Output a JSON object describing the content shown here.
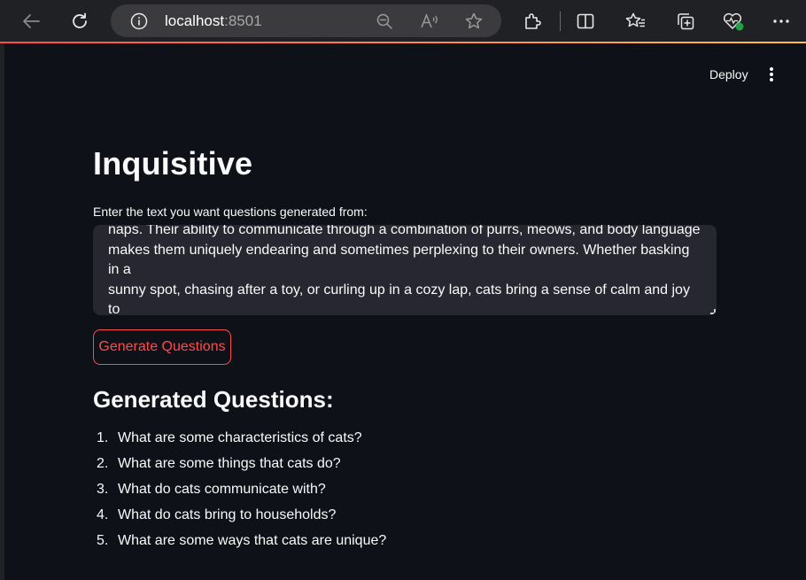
{
  "browser": {
    "url_host": "localhost",
    "url_port": ":8501",
    "icons": [
      "back-icon",
      "refresh-icon",
      "info-icon",
      "zoom-icon",
      "read-aloud-icon",
      "favorite-star-icon",
      "extensions-icon",
      "split-screen-icon",
      "favorites-icon",
      "collections-icon",
      "browser-essentials-icon",
      "more-icon"
    ],
    "accent_colors": [
      "#ff4b4b",
      "#ffbd45"
    ]
  },
  "header": {
    "deploy_label": "Deploy"
  },
  "main": {
    "title": "Inquisitive",
    "input_label": "Enter the text you want questions generated from:",
    "input_value": "naps. Their ability to communicate through a combination of purrs, meows, and body language\nmakes them uniquely endearing and sometimes perplexing to their owners. Whether basking in a\nsunny spot, chasing after a toy, or curling up in a cozy lap, cats bring a sense of calm and joy to\nhouseholds around the world, embodying a perfect blend of affection and autonomy.",
    "button_label": "Generate Questions",
    "button_color": "#ff4b4b",
    "section_title": "Generated Questions:",
    "questions": [
      {
        "num": "1.",
        "text": "What are some characteristics of cats?"
      },
      {
        "num": "2.",
        "text": "What are some things that cats do?"
      },
      {
        "num": "3.",
        "text": "What do cats communicate with?"
      },
      {
        "num": "4.",
        "text": "What do cats bring to households?"
      },
      {
        "num": "5.",
        "text": "What are some ways that cats are unique?"
      }
    ]
  },
  "theme": {
    "background": "#0e1117",
    "input_background": "#262730",
    "text": "#fafafa"
  }
}
